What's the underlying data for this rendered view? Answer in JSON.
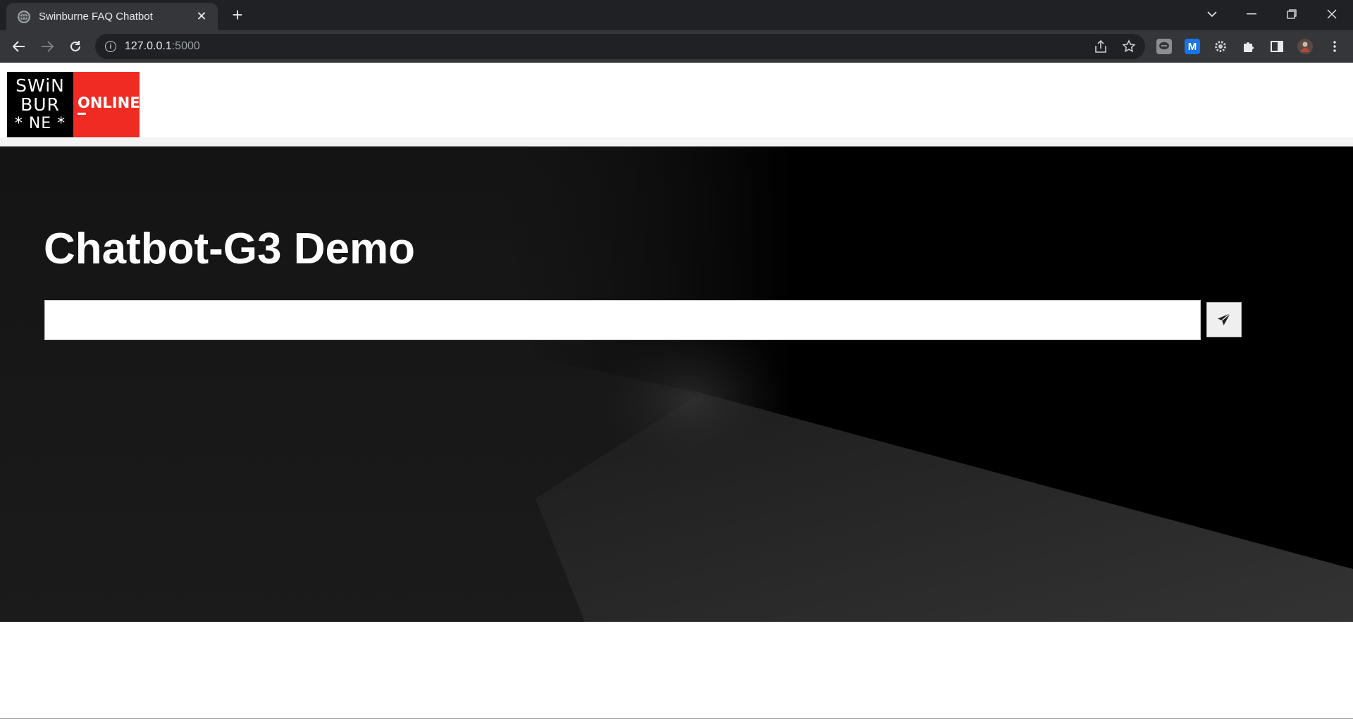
{
  "browser": {
    "tab": {
      "title": "Swinburne FAQ Chatbot",
      "close_glyph": "✕",
      "favicon": "globe-icon"
    },
    "new_tab_glyph": "+",
    "address": {
      "host": "127.0.0.1",
      "port": ":5000"
    },
    "extensions": [
      "line-chat-icon",
      "m-extension-icon",
      "gear-extension-icon",
      "puzzle-icon",
      "side-panel-icon",
      "avatar"
    ],
    "m_extension_letter": "M"
  },
  "site": {
    "logo": {
      "line1": "SWiN",
      "line2": "BUR",
      "line3": "* NE *",
      "online": "ONLINE",
      "brand_red": "#ef2b24"
    },
    "hero": {
      "title": "Chatbot-G3 Demo"
    },
    "chat": {
      "value": "",
      "send_icon": "paper-plane-icon"
    }
  }
}
